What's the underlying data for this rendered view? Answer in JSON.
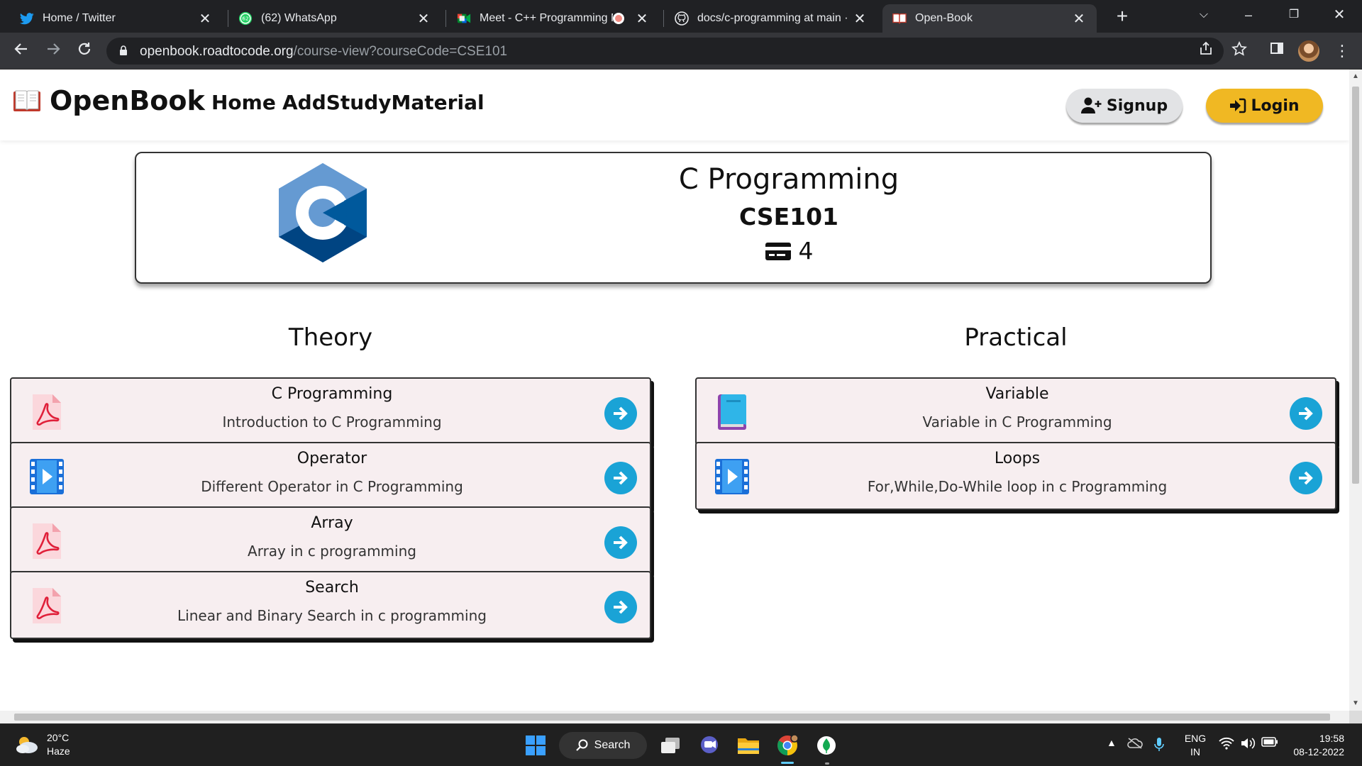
{
  "browser": {
    "tabs": [
      {
        "title": "Home / Twitter",
        "icon": "twitter-icon",
        "active": false
      },
      {
        "title": "(62) WhatsApp",
        "icon": "whatsapp-icon",
        "badge": "62",
        "active": false
      },
      {
        "title": "Meet - C++ Programming N",
        "icon": "google-meet-icon",
        "active": false
      },
      {
        "title": "docs/c-programming at main · r",
        "icon": "github-icon",
        "active": false
      },
      {
        "title": "Open-Book",
        "icon": "open-book-icon",
        "active": true
      }
    ],
    "url_host": "openbook.roadtocode.org",
    "url_path": "/course-view?courseCode=CSE101"
  },
  "site": {
    "brand": "OpenBook",
    "nav": {
      "home": "Home",
      "add": "AddStudyMaterial"
    },
    "signup_label": "Signup",
    "login_label": "Login",
    "accent_login": "#f0b823",
    "accent_go": "#1aa3d6"
  },
  "course": {
    "title": "C Programming",
    "code": "CSE101",
    "credits": "4"
  },
  "sections": {
    "theory_title": "Theory",
    "practical_title": "Practical",
    "theory": [
      {
        "title": "C Programming",
        "subtitle": "Introduction to C Programming",
        "icon": "pdf-icon"
      },
      {
        "title": "Operator",
        "subtitle": "Different Operator in C Programming",
        "icon": "video-icon"
      },
      {
        "title": "Array",
        "subtitle": "Array in c programming",
        "icon": "pdf-icon"
      },
      {
        "title": "Search",
        "subtitle": "Linear and Binary Search in c programming",
        "icon": "pdf-icon"
      }
    ],
    "practical": [
      {
        "title": "Variable",
        "subtitle": "Variable in C Programming",
        "icon": "notebook-icon"
      },
      {
        "title": "Loops",
        "subtitle": "For,While,Do-While loop in c Programming",
        "icon": "video-icon"
      }
    ]
  },
  "taskbar": {
    "temp": "20°C",
    "condition": "Haze",
    "search": "Search",
    "lang_1": "ENG",
    "lang_2": "IN",
    "time": "19:58",
    "date": "08-12-2022"
  }
}
